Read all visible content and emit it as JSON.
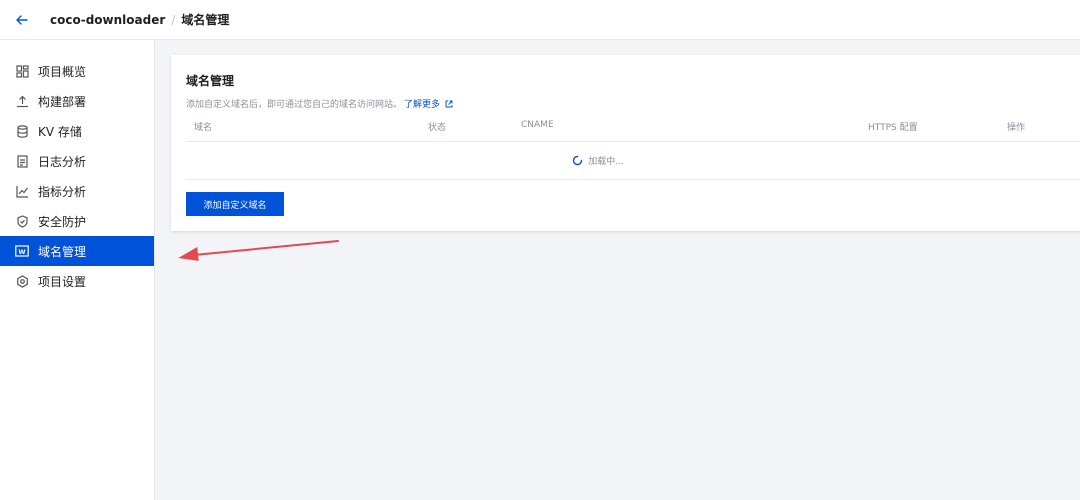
{
  "header": {
    "project": "coco-downloader",
    "separator": "/",
    "current": "域名管理"
  },
  "sidebar": {
    "items": [
      {
        "label": "项目概览",
        "icon": "overview-grid-icon"
      },
      {
        "label": "构建部署",
        "icon": "upload-icon"
      },
      {
        "label": "KV 存储",
        "icon": "database-icon"
      },
      {
        "label": "日志分析",
        "icon": "document-icon"
      },
      {
        "label": "指标分析",
        "icon": "line-chart-icon"
      },
      {
        "label": "安全防护",
        "icon": "shield-icon"
      },
      {
        "label": "域名管理",
        "icon": "www-icon",
        "active": true
      },
      {
        "label": "项目设置",
        "icon": "settings-hexagon-icon"
      }
    ]
  },
  "main": {
    "title": "域名管理",
    "description": "添加自定义域名后，即可通过您自己的域名访问网站。",
    "learn_more": "了解更多",
    "table": {
      "columns": [
        "域名",
        "状态",
        "CNAME",
        "HTTPS 配置",
        "操作"
      ]
    },
    "loading_text": "加载中...",
    "add_button": "添加自定义域名"
  },
  "colors": {
    "accent": "#0052d9",
    "annotation_arrow": "#e5484d"
  }
}
